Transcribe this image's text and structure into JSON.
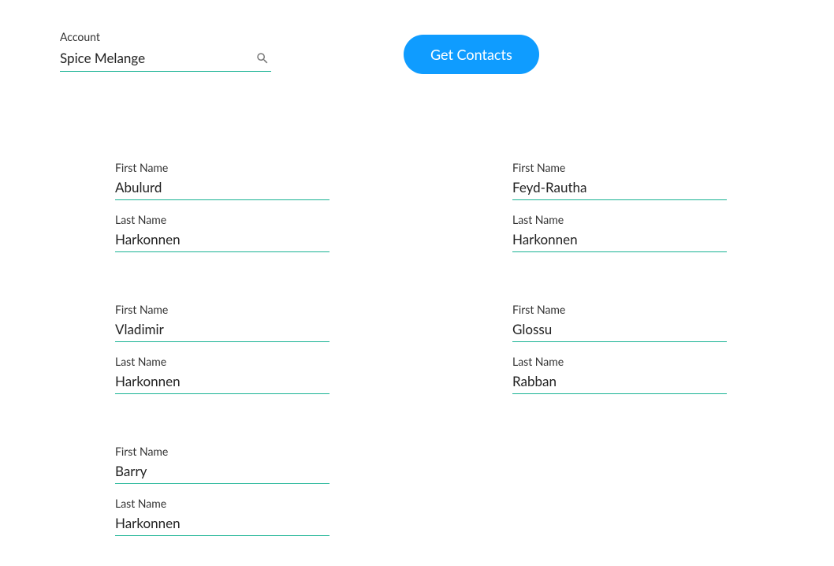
{
  "account": {
    "label": "Account",
    "value": "Spice Melange"
  },
  "actions": {
    "get_contacts_label": "Get Contacts"
  },
  "labels": {
    "first_name": "First Name",
    "last_name": "Last Name"
  },
  "contacts": [
    {
      "first_name": "Abulurd",
      "last_name": "Harkonnen"
    },
    {
      "first_name": "Feyd-Rautha",
      "last_name": "Harkonnen"
    },
    {
      "first_name": "Vladimir",
      "last_name": "Harkonnen"
    },
    {
      "first_name": "Glossu",
      "last_name": "Rabban"
    },
    {
      "first_name": "Barry",
      "last_name": "Harkonnen"
    }
  ]
}
